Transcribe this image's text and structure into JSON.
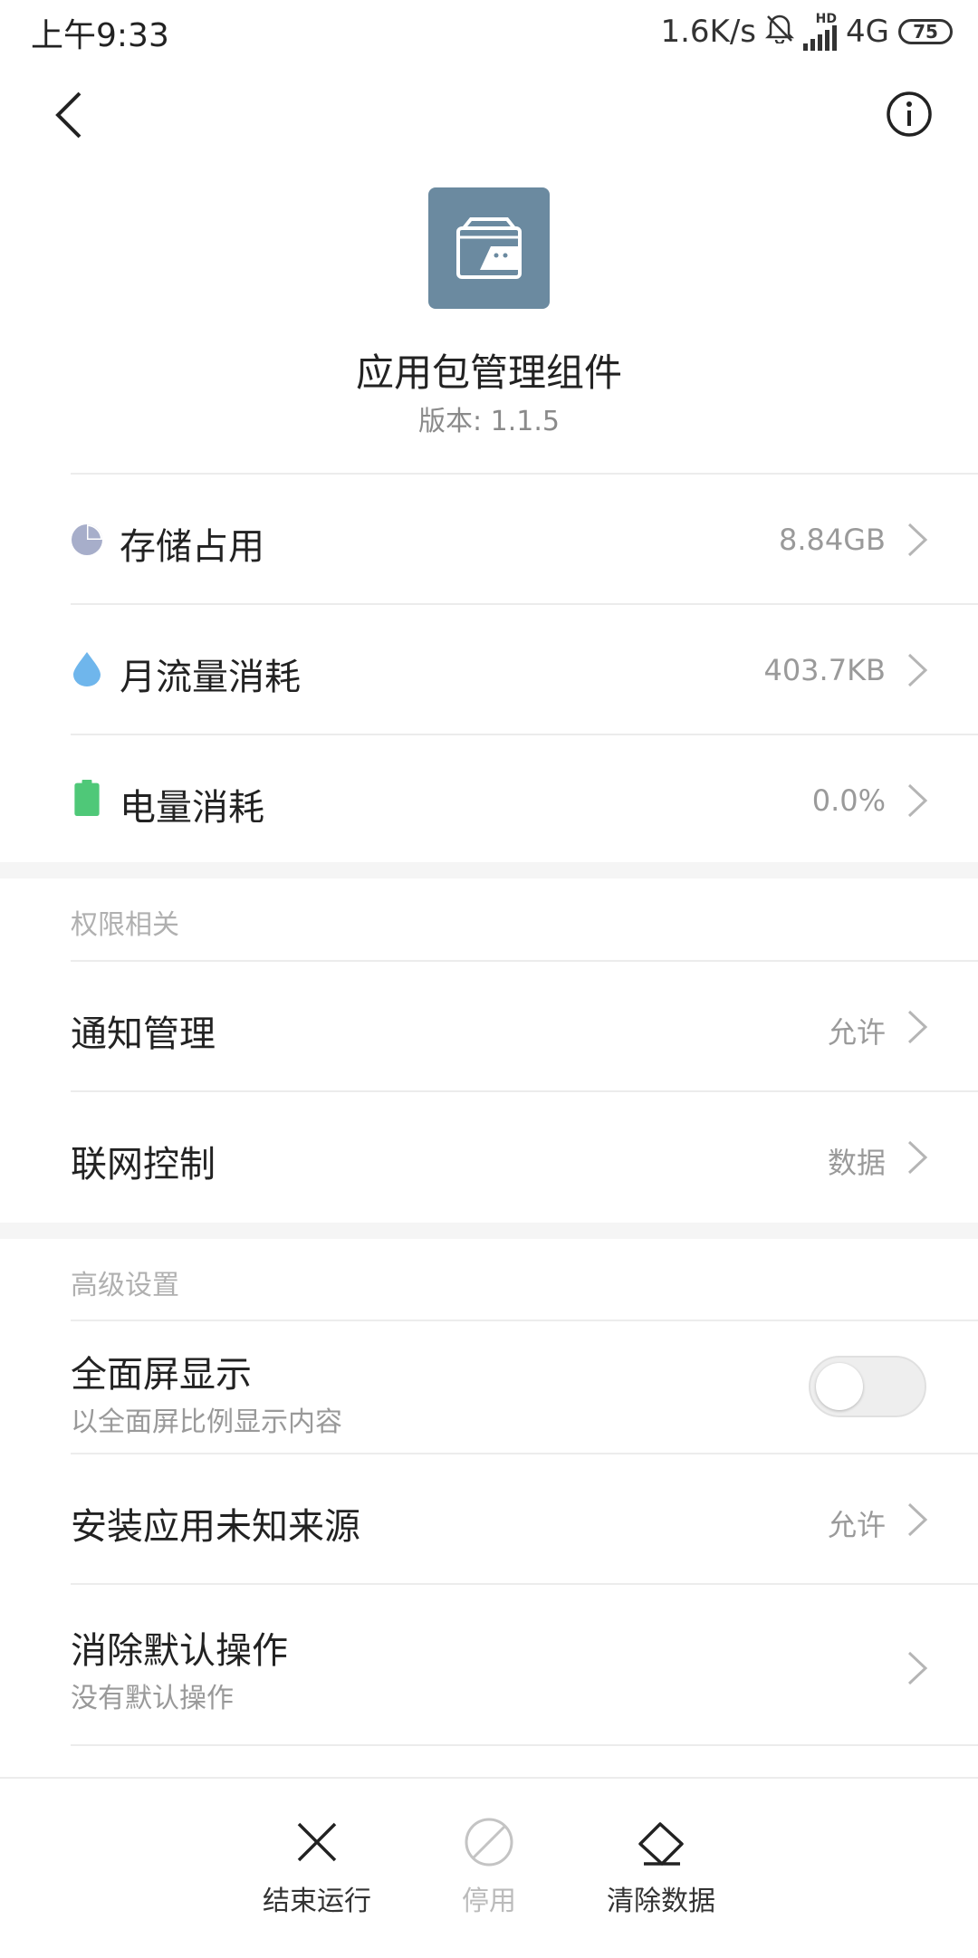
{
  "status_bar": {
    "time": "上午9:33",
    "net_speed": "1.6K/s",
    "hd_badge": "HD",
    "network": "4G",
    "battery": "75"
  },
  "header": {
    "app_name": "应用包管理组件",
    "version": "版本: 1.1.5"
  },
  "usage": [
    {
      "label": "存储占用",
      "value": "8.84GB",
      "icon": "pie-chart-icon",
      "color": "#a7aeca"
    },
    {
      "label": "月流量消耗",
      "value": "403.7KB",
      "icon": "water-drop-icon",
      "color": "#6fb6ec"
    },
    {
      "label": "电量消耗",
      "value": "0.0%",
      "icon": "battery-icon",
      "color": "#4fc878"
    }
  ],
  "permissions": {
    "section_title": "权限相关",
    "items": [
      {
        "label": "通知管理",
        "value": "允许"
      },
      {
        "label": "联网控制",
        "value": "数据"
      }
    ]
  },
  "advanced": {
    "section_title": "高级设置",
    "fullscreen": {
      "label": "全面屏显示",
      "sub": "以全面屏比例显示内容",
      "enabled": false
    },
    "unknown_sources": {
      "label": "安装应用未知来源",
      "value": "允许"
    },
    "clear_defaults": {
      "label": "消除默认操作",
      "sub": "没有默认操作"
    }
  },
  "actions": {
    "force_stop": "结束运行",
    "disable": "停用",
    "clear_data": "清除数据"
  }
}
